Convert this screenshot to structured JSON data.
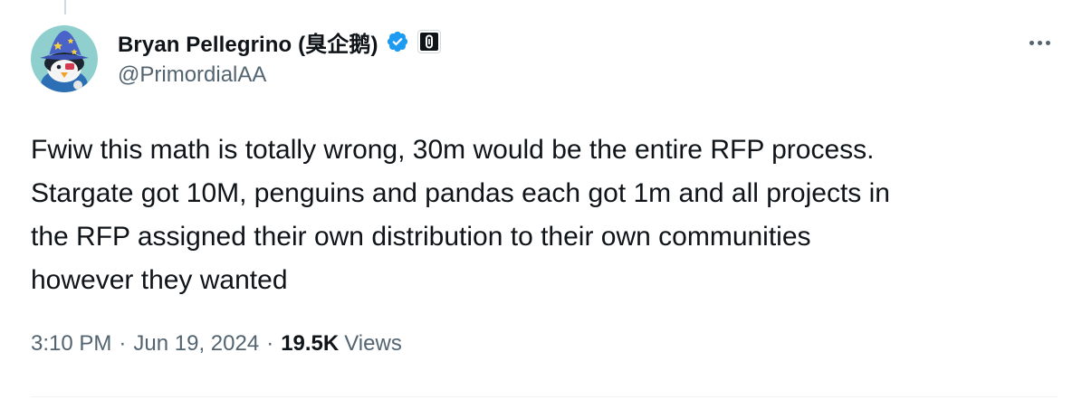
{
  "author": {
    "display_name": "Bryan Pellegrino (臭企鹅)",
    "handle": "@PrimordialAA",
    "verified_color": "#1d9bf0",
    "avatar_icon": "penguin-wizard-avatar-icon",
    "affiliate_icon": "affiliate-badge-icon"
  },
  "tweet": {
    "lines": [
      "Fwiw this math is totally wrong, 30m would be the entire RFP process.",
      "Stargate got 10M, penguins and pandas each got 1m and all projects in",
      "the RFP assigned their own distribution to their own communities",
      "however they wanted"
    ]
  },
  "meta": {
    "time": "3:10 PM",
    "separator": "·",
    "date": "Jun 19, 2024",
    "views_count": "19.5K",
    "views_label": "Views"
  },
  "more_icon": "more-options-icon"
}
